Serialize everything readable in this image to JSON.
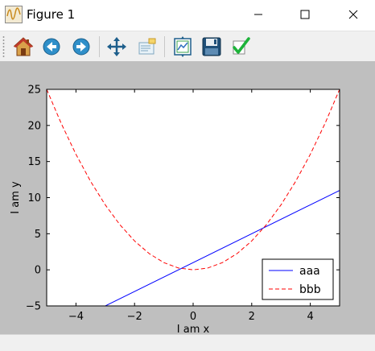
{
  "window": {
    "title": "Figure 1",
    "title_icon": "matplotlib-figure-icon",
    "controls": [
      "minimize-icon",
      "maximize-icon",
      "close-icon"
    ]
  },
  "toolbar": {
    "buttons": [
      {
        "name": "home-button",
        "icon": "home-icon"
      },
      {
        "name": "back-button",
        "icon": "arrow-left-icon"
      },
      {
        "name": "forward-button",
        "icon": "arrow-right-icon"
      },
      {
        "name": "pan-button",
        "icon": "move-arrows-icon"
      },
      {
        "name": "zoom-button",
        "icon": "zoom-rect-icon"
      },
      {
        "name": "subplots-button",
        "icon": "subplots-config-icon"
      },
      {
        "name": "save-button",
        "icon": "floppy-disk-icon"
      },
      {
        "name": "edit-params-button",
        "icon": "checkmark-icon"
      }
    ]
  },
  "colors": {
    "canvas_bg": "#bfbfbf",
    "axes_bg": "#ffffff",
    "series_aaa": "#0000ff",
    "series_bbb": "#ff0000"
  },
  "chart_data": {
    "type": "line",
    "xlabel": "I am x",
    "ylabel": "I am y",
    "xlim": [
      -5,
      5
    ],
    "ylim": [
      -5,
      25
    ],
    "xticks": [
      -4,
      -2,
      0,
      2,
      4
    ],
    "xtick_labels": [
      "−4",
      "−2",
      "0",
      "2",
      "4"
    ],
    "yticks": [
      -5,
      0,
      5,
      10,
      15,
      20,
      25
    ],
    "ytick_labels": [
      "−5",
      "0",
      "5",
      "10",
      "15",
      "20",
      "25"
    ],
    "grid": false,
    "legend": "lower-right",
    "series": [
      {
        "name": "aaa",
        "style": "solid",
        "color": "#0000ff",
        "function": "2*x+1",
        "x": [
          -5,
          5
        ],
        "y": [
          -9,
          11
        ]
      },
      {
        "name": "bbb",
        "style": "dashed",
        "color": "#ff0000",
        "function": "x^2",
        "x": [
          -5,
          -4.5,
          -4,
          -3.5,
          -3,
          -2.5,
          -2,
          -1.5,
          -1,
          -0.5,
          0,
          0.5,
          1,
          1.5,
          2,
          2.5,
          3,
          3.5,
          4,
          4.5,
          5
        ],
        "y": [
          25,
          20.25,
          16,
          12.25,
          9,
          6.25,
          4,
          2.25,
          1,
          0.25,
          0,
          0.25,
          1,
          2.25,
          4,
          6.25,
          9,
          12.25,
          16,
          20.25,
          25
        ]
      }
    ]
  }
}
